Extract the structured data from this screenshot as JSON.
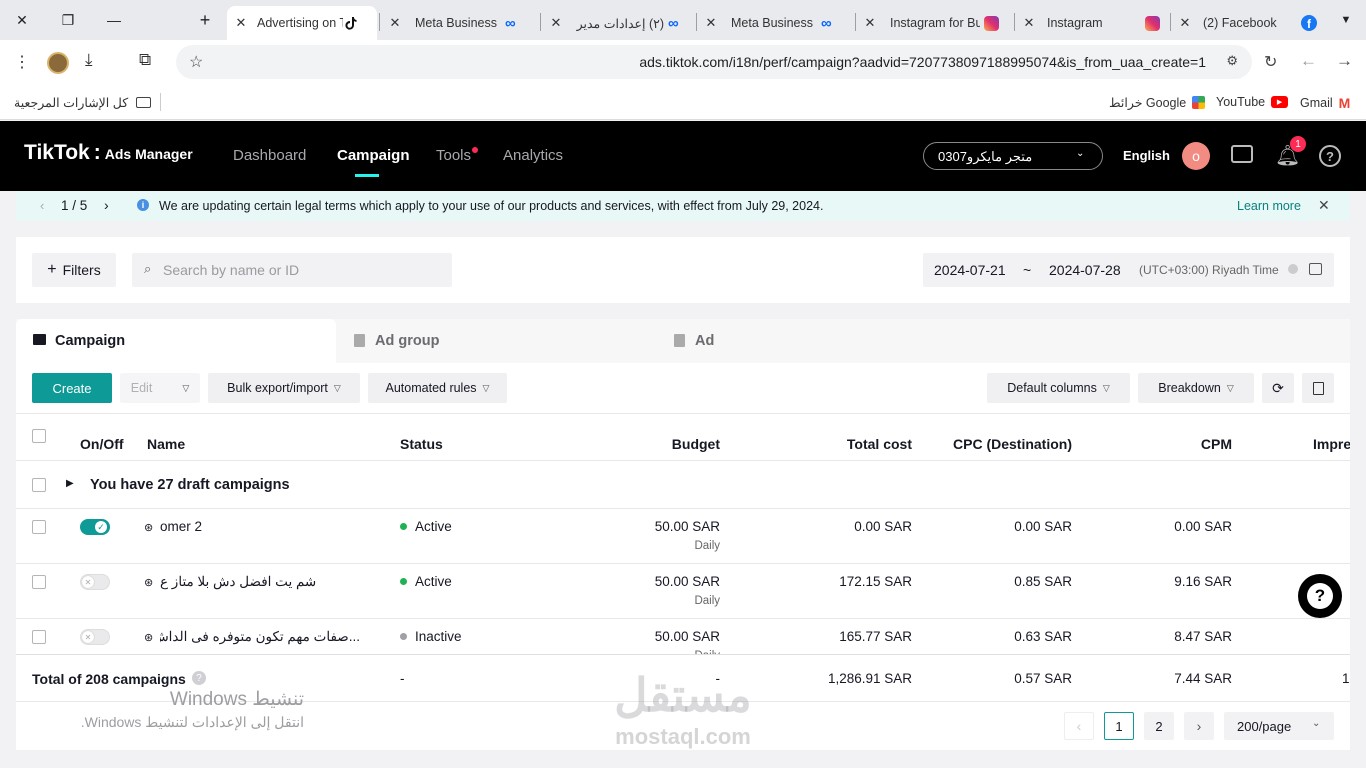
{
  "browser": {
    "tabs": [
      {
        "title": "Advertising on TikTok",
        "icon": "tiktok-icon",
        "active": true
      },
      {
        "title": "Meta Business Suite",
        "icon": "meta-icon"
      },
      {
        "title": "(٢) إعدادات مدير",
        "icon": "meta-icon"
      },
      {
        "title": "Meta Business Suite",
        "icon": "meta-icon"
      },
      {
        "title": "Instagram for Business",
        "icon": "instagram-icon"
      },
      {
        "title": "Instagram",
        "icon": "instagram-icon"
      },
      {
        "title": "(2) Facebook",
        "icon": "facebook-icon"
      }
    ],
    "url": "ads.tiktok.com/i18n/perf/campaign?aadvid=7207738097188995074&is_from_uaa_create=1",
    "bookmarks": {
      "all": "كل الإشارات المرجعية",
      "gmail": "Gmail",
      "youtube": "YouTube",
      "maps": "خرائط Google"
    }
  },
  "header": {
    "logo": "TikTok",
    "logo_suffix": "Ads Manager",
    "nav": [
      "Dashboard",
      "Campaign",
      "Tools",
      "Analytics"
    ],
    "account": "متجر مايكرو0307",
    "language": "English",
    "avatar_letter": "o",
    "notif_count": "1"
  },
  "notice": {
    "pager": "1 / 5",
    "text": "We are updating certain legal terms which apply to your use of our products and services, with effect from July 29, 2024.",
    "link": "Learn more"
  },
  "filterbar": {
    "filters": "Filters",
    "search_placeholder": "Search by name or ID",
    "date_from": "2024-07-21",
    "date_sep": "~",
    "date_to": "2024-07-28",
    "timezone": "(UTC+03:00) Riyadh Time"
  },
  "levels": [
    "Campaign",
    "Ad group",
    "Ad"
  ],
  "toolbar": {
    "create": "Create",
    "edit": "Edit",
    "bulk": "Bulk export/import",
    "rules": "Automated rules",
    "columns": "Default columns",
    "breakdown": "Breakdown"
  },
  "table": {
    "headers": [
      "On/Off",
      "Name",
      "Status",
      "Budget",
      "Total cost",
      "CPC (Destination)",
      "CPM",
      "Impre"
    ],
    "draft": "You have 27 draft campaigns",
    "rows": [
      {
        "name": "omer 2",
        "on": true,
        "status": "Active",
        "status_color": "#1fb255",
        "budget": "50.00 SAR",
        "budget_type": "Daily",
        "cost": "0.00 SAR",
        "cpc": "0.00 SAR",
        "cpm": "0.00 SAR"
      },
      {
        "name": "شم يت افضل دش بلا متاز ع",
        "on": false,
        "status": "Active",
        "status_color": "#1fb255",
        "budget": "50.00 SAR",
        "budget_type": "Daily",
        "cost": "172.15 SAR",
        "cpc": "0.85 SAR",
        "cpm": "9.16 SAR"
      },
      {
        "name": "...صفات مهم تكون متوفره فى الداش",
        "on": false,
        "status": "Inactive",
        "status_color": "#a0a0a5",
        "budget": "50.00 SAR",
        "budget_type": "Daily",
        "cost": "165.77 SAR",
        "cpc": "0.63 SAR",
        "cpm": "8.47 SAR"
      }
    ],
    "total": {
      "label": "Total of 208 campaigns",
      "status": "-",
      "budget": "-",
      "cost": "1,286.91 SAR",
      "cpc": "0.57 SAR",
      "cpm": "7.44 SAR",
      "impre": "1"
    }
  },
  "pagination": {
    "pages": [
      "1",
      "2"
    ],
    "per_page": "200/page"
  },
  "overlay": {
    "win_title": "تنشيط Windows",
    "win_sub": "انتقل إلى الإعدادات لتنشيط Windows.",
    "watermark": "مستقل",
    "watermark_sub": "mostaql.com"
  },
  "colors": {
    "accent": "#1f9a98",
    "create": "#0e9a96",
    "tiktok_red": "#fe2c55"
  }
}
